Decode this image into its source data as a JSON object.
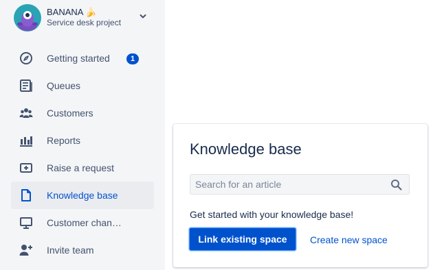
{
  "project": {
    "name": "BANANA 🍌",
    "type": "Service desk project",
    "avatar_icon": "project-avatar-monster"
  },
  "sidebar": {
    "items": [
      {
        "label": "Getting started",
        "icon": "compass-icon",
        "badge": "1"
      },
      {
        "label": "Queues",
        "icon": "queues-icon"
      },
      {
        "label": "Customers",
        "icon": "people-icon"
      },
      {
        "label": "Reports",
        "icon": "graph-bar-icon"
      },
      {
        "label": "Raise a request",
        "icon": "add-item-icon"
      },
      {
        "label": "Knowledge base",
        "icon": "page-icon",
        "active": true
      },
      {
        "label": "Customer chan…",
        "icon": "screen-icon"
      },
      {
        "label": "Invite team",
        "icon": "invite-team-icon"
      }
    ]
  },
  "card": {
    "title": "Knowledge base",
    "search_placeholder": "Search for an article",
    "helper_text": "Get started with your knowledge base!",
    "primary_button": "Link existing space",
    "secondary_link": "Create new space"
  },
  "colors": {
    "accent": "#0052cc",
    "sidebar_bg": "#f4f5f7",
    "active_item_bg": "#ebecf0",
    "text_primary": "#172b4d",
    "text_secondary": "#42526e"
  }
}
